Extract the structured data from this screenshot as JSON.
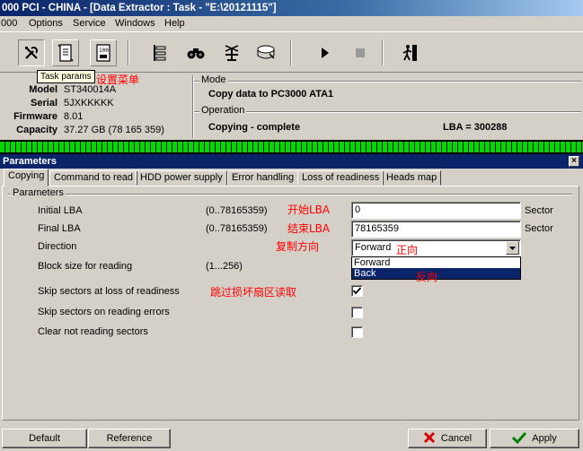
{
  "window": {
    "title": "000 PCI - CHINA - [Data Extractor : Task - \"E:\\20121115\"]"
  },
  "menu": {
    "items": [
      "000",
      "Options",
      "Service",
      "Windows",
      "Help"
    ]
  },
  "tooltip": "Task params",
  "annotations": {
    "settings_menu": "设置菜单",
    "start_lba": "开始LBA",
    "end_lba": "结束LBA",
    "copy_direction": "复制方向",
    "forward": "正向",
    "reverse": "反向",
    "skip_bad": "跳过损坏扇区读取"
  },
  "drive": {
    "model_label": "Model",
    "model": "ST340014A",
    "serial_label": "Serial",
    "serial": "5JXKKKKK",
    "firmware_label": "Firmware",
    "firmware": "8.01",
    "capacity_label": "Capacity",
    "capacity": "37.27 GB (78 165 359)"
  },
  "mode": {
    "title": "Mode",
    "value": "Copy data to PC3000 ATA1"
  },
  "operation": {
    "title": "Operation",
    "value": "Copying - complete",
    "lba": "LBA = 300288"
  },
  "parameters": {
    "title": "Parameters",
    "close_symbol": "×",
    "group_title": "Parameters",
    "tabs": [
      "Copying",
      "Command to read",
      "HDD power supply",
      "Error handling",
      "Loss of readiness",
      "Heads map"
    ],
    "initial_lba": {
      "label": "Initial LBA",
      "range": "(0..78165359)",
      "value": "0",
      "unit": "Sector"
    },
    "final_lba": {
      "label": "Final LBA",
      "range": "(0..78165359)",
      "value": "78165359",
      "unit": "Sector"
    },
    "direction": {
      "label": "Direction",
      "value": "Forward",
      "options": [
        "Forward",
        "Back"
      ],
      "highlighted": "Back"
    },
    "block_size": {
      "label": "Block size for reading",
      "range": "(1...256)"
    },
    "skip_loss": {
      "label": "Skip sectors at loss of readiness",
      "checked": true
    },
    "skip_errors": {
      "label": "Skip sectors on reading errors",
      "checked": false
    },
    "clear_not_reading": {
      "label": "Clear not reading sectors",
      "checked": false
    }
  },
  "buttons": {
    "default": "Default",
    "reference": "Reference",
    "cancel": "Cancel",
    "apply": "Apply"
  },
  "colors": {
    "title_bar": "#0a246a",
    "status_green": "#00d800",
    "annotation_red": "#ff0000",
    "face": "#d4d0c8"
  }
}
